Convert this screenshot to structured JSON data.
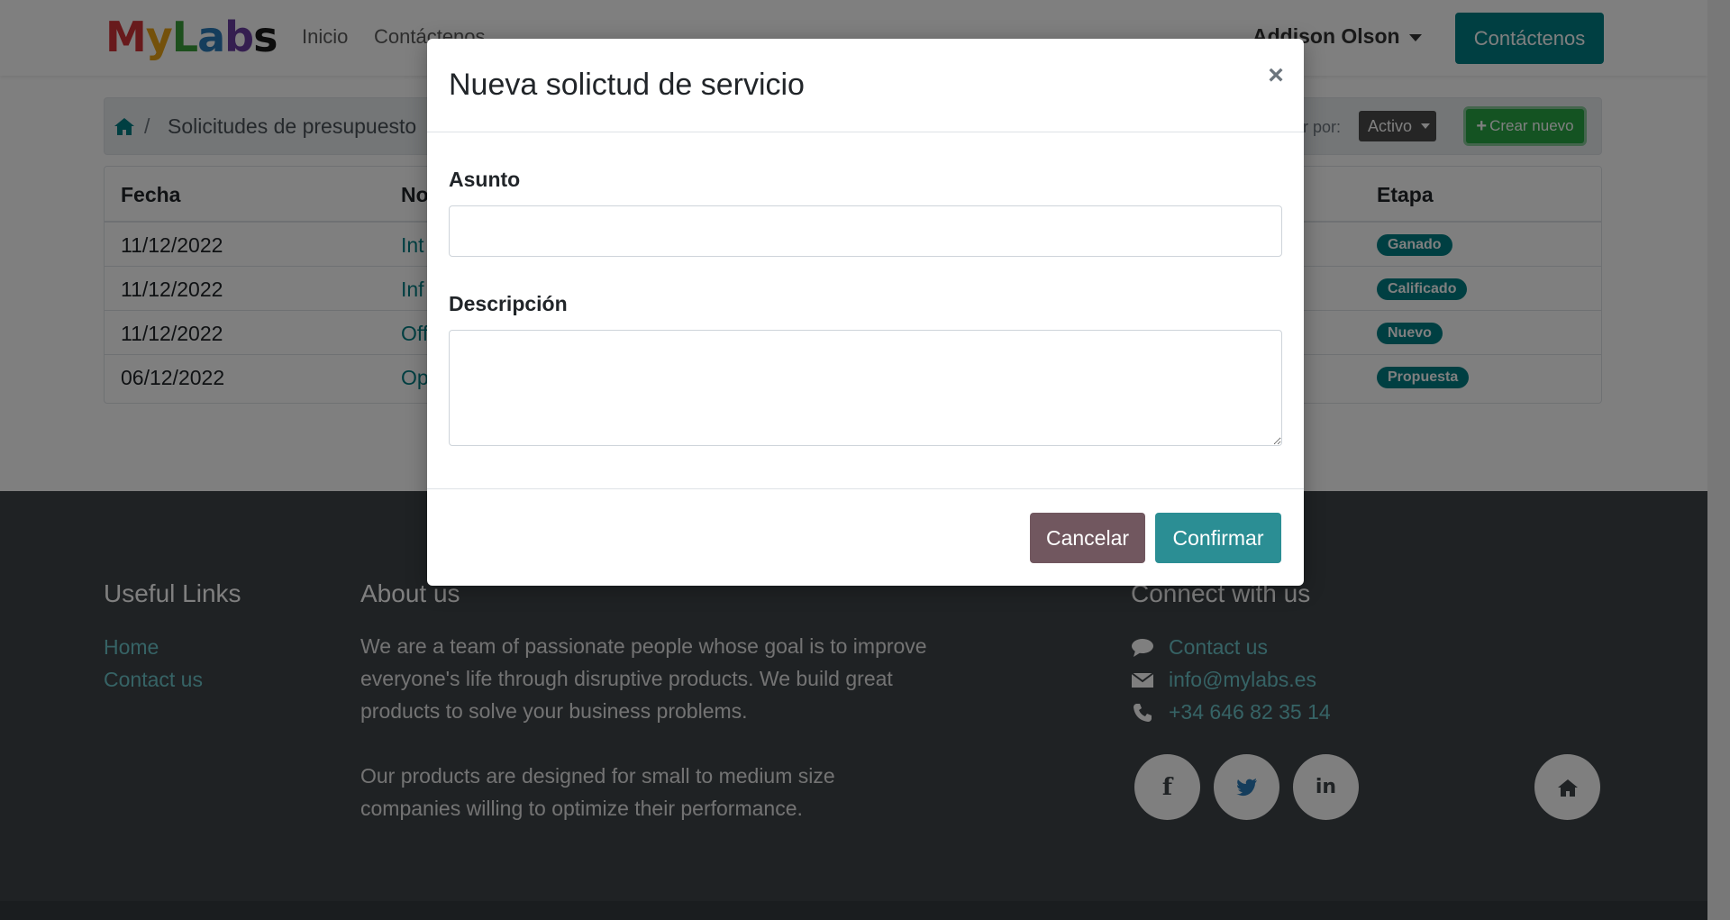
{
  "navbar": {
    "logo_letters": [
      "M",
      "y",
      "L",
      "a",
      "b",
      "s"
    ],
    "links": [
      "Inicio",
      "Contáctenos"
    ],
    "user_name": "Addison Olson",
    "cta_label": "Contáctenos"
  },
  "breadcrumb": {
    "separator": "/",
    "current": "Solicitudes de presupuesto",
    "filter_label": "ar por:",
    "filter_value": "Activo",
    "create_label": "Crear nuevo",
    "create_icon": "plus-icon"
  },
  "table": {
    "headers": [
      "Fecha",
      "No",
      "Etapa"
    ],
    "rows": [
      {
        "date": "11/12/2022",
        "name": "Int",
        "stage": "Ganado"
      },
      {
        "date": "11/12/2022",
        "name": "Inf",
        "stage": "Calificado"
      },
      {
        "date": "11/12/2022",
        "name": "Off",
        "stage": "Nuevo"
      },
      {
        "date": "06/12/2022",
        "name": "Op",
        "stage": "Propuesta"
      }
    ]
  },
  "footer": {
    "useful_links_title": "Useful Links",
    "useful_links": [
      "Home",
      "Contact us"
    ],
    "about_title": "About us",
    "about_lines_1": [
      "We are a team of passionate people whose goal is to improve",
      "everyone's life through disruptive products. We build great",
      "products to solve your business problems."
    ],
    "about_lines_2": [
      "Our products are designed for small to medium size",
      "companies willing to optimize their performance."
    ],
    "connect_title": "Connect with us",
    "contact_items": [
      {
        "icon": "comment-icon",
        "text": "Contact us"
      },
      {
        "icon": "envelope-icon",
        "text": "info@mylabs.es"
      },
      {
        "icon": "phone-icon",
        "text": "+34 646 82 35 14"
      }
    ],
    "social": [
      "facebook-icon",
      "twitter-icon",
      "linkedin-icon",
      "home-icon"
    ]
  },
  "modal": {
    "title": "Nueva solictud de servicio",
    "close_glyph": "×",
    "subject_label": "Asunto",
    "subject_value": "",
    "description_label": "Descripción",
    "description_value": "",
    "cancel_label": "Cancelar",
    "confirm_label": "Confirmar"
  },
  "colors": {
    "brand": "#017e84",
    "badge": "#017e84",
    "create_button": "#28a745",
    "cancel_button": "#71575f",
    "confirm_button": "#2b8e94",
    "footer_bg": "#3f4449",
    "backdrop": "rgba(0,0,0,0.5)"
  }
}
